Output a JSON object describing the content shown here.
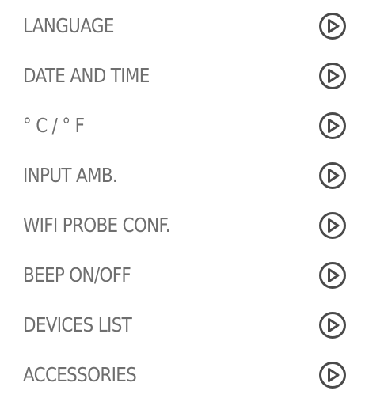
{
  "settings_menu": {
    "items": [
      {
        "label": "LANGUAGE",
        "icon": "play-circle-icon"
      },
      {
        "label": "DATE AND TIME",
        "icon": "play-circle-icon"
      },
      {
        "label": "° C / ° F",
        "icon": "play-circle-icon"
      },
      {
        "label": "INPUT AMB.",
        "icon": "play-circle-icon"
      },
      {
        "label": "WIFI PROBE CONF.",
        "icon": "play-circle-icon"
      },
      {
        "label": "BEEP ON/OFF",
        "icon": "play-circle-icon"
      },
      {
        "label": "DEVICES LIST",
        "icon": "play-circle-icon"
      },
      {
        "label": "ACCESSORIES",
        "icon": "play-circle-icon"
      }
    ]
  },
  "colors": {
    "text": "#6e6e6e",
    "icon": "#4a4a4a",
    "background": "#ffffff"
  }
}
